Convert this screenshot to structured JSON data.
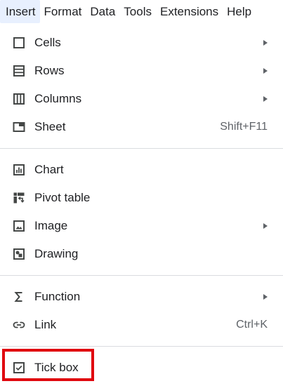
{
  "menubar": {
    "items": [
      {
        "label": "Insert",
        "active": true
      },
      {
        "label": "Format"
      },
      {
        "label": "Data"
      },
      {
        "label": "Tools"
      },
      {
        "label": "Extensions"
      },
      {
        "label": "Help"
      }
    ]
  },
  "menu": {
    "items": [
      {
        "label": "Cells",
        "icon": "cells-icon",
        "submenu": true
      },
      {
        "label": "Rows",
        "icon": "rows-icon",
        "submenu": true
      },
      {
        "label": "Columns",
        "icon": "columns-icon",
        "submenu": true
      },
      {
        "label": "Sheet",
        "icon": "sheet-icon",
        "shortcut": "Shift+F11"
      },
      {
        "label": "Chart",
        "icon": "chart-icon"
      },
      {
        "label": "Pivot table",
        "icon": "pivot-table-icon"
      },
      {
        "label": "Image",
        "icon": "image-icon",
        "submenu": true
      },
      {
        "label": "Drawing",
        "icon": "drawing-icon"
      },
      {
        "label": "Function",
        "icon": "sigma-icon",
        "submenu": true
      },
      {
        "label": "Link",
        "icon": "link-icon",
        "shortcut": "Ctrl+K"
      },
      {
        "label": "Tick box",
        "icon": "checkbox-icon",
        "highlighted": true
      }
    ]
  },
  "colors": {
    "active_tab_bg": "#e8f0fe",
    "separator": "#dadce0",
    "highlight_border": "#e0070f",
    "icon": "#444746"
  }
}
